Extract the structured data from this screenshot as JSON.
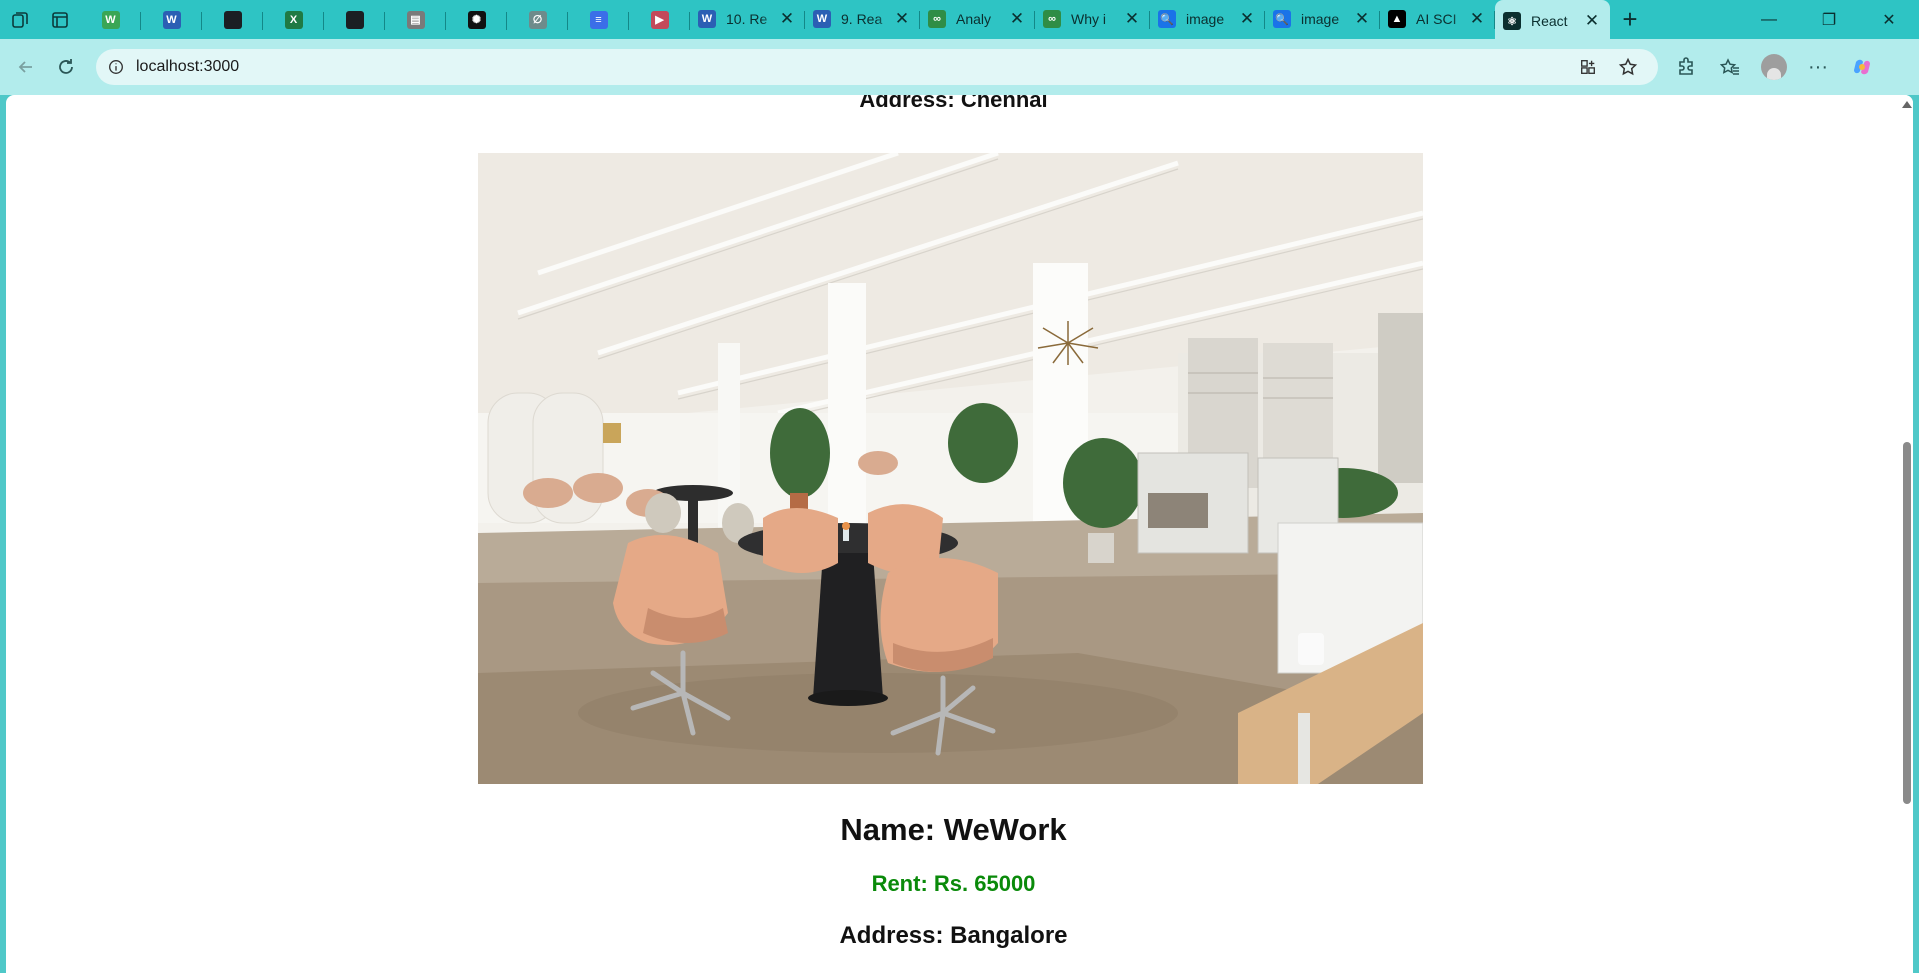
{
  "browser": {
    "pinned_tabs": [
      {
        "icon": "wix-icon",
        "color": "#3aa655",
        "glyph": "W"
      },
      {
        "icon": "word-icon",
        "color": "#2b5fb4",
        "glyph": "W"
      },
      {
        "icon": "github-icon",
        "color": "#1b1f23",
        "glyph": ""
      },
      {
        "icon": "excel-icon",
        "color": "#1f7a44",
        "glyph": "X"
      },
      {
        "icon": "github-icon",
        "color": "#1b1f23",
        "glyph": ""
      },
      {
        "icon": "pdf-icon",
        "color": "#7a7a7a",
        "glyph": "▤"
      },
      {
        "icon": "chatgpt-icon",
        "color": "#111111",
        "glyph": "✺"
      },
      {
        "icon": "perplexity-icon",
        "color": "#6e8b8b",
        "glyph": "∅"
      },
      {
        "icon": "docs-icon",
        "color": "#3b6ee8",
        "glyph": "≡"
      },
      {
        "icon": "youtube-icon",
        "color": "#c44a5a",
        "glyph": "▶"
      }
    ],
    "tabs": [
      {
        "icon": "word-icon",
        "color": "#2b5fb4",
        "glyph": "W",
        "title": "10. Re"
      },
      {
        "icon": "word-icon",
        "color": "#2b5fb4",
        "glyph": "W",
        "title": "9. Rea"
      },
      {
        "icon": "geeksforgeeks-icon",
        "color": "#2f8d46",
        "glyph": "∞",
        "title": "Analy"
      },
      {
        "icon": "geeksforgeeks-icon",
        "color": "#2f8d46",
        "glyph": "∞",
        "title": "Why i"
      },
      {
        "icon": "search-icon",
        "color": "#1a73e8",
        "glyph": "🔍",
        "title": "image"
      },
      {
        "icon": "search-icon",
        "color": "#1a73e8",
        "glyph": "🔍",
        "title": "image"
      },
      {
        "icon": "ai-icon",
        "color": "#000000",
        "glyph": "▲",
        "title": "AI SCI"
      },
      {
        "icon": "react-icon",
        "color": "#0b2f2f",
        "glyph": "⚛",
        "title": "React",
        "active": true
      }
    ],
    "address": "localhost:3000"
  },
  "page": {
    "prev_address": "Address: Chennai",
    "listing": {
      "name": "Name: WeWork",
      "rent": "Rent: Rs. 65000",
      "address": "Address: Bangalore"
    }
  },
  "colors": {
    "rent_green": "#0a8a0a",
    "tabstrip": "#2ec4c4",
    "toolbar": "#b2ecec"
  }
}
